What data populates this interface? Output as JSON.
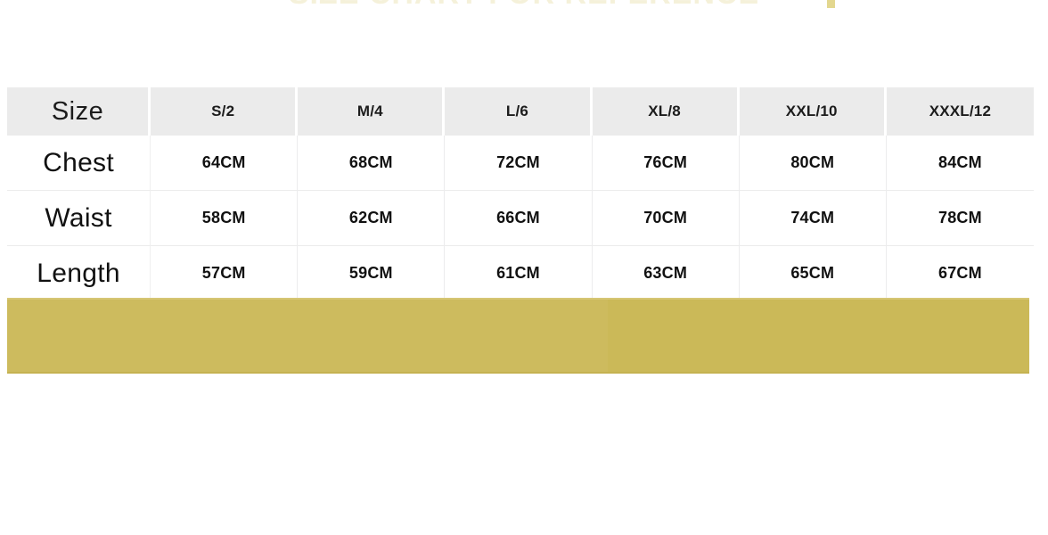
{
  "banner": {
    "title_text": "SIZE CHART FOR REFERENCE",
    "title_color": "#f4efd4",
    "accent_color": "#d9c96a"
  },
  "size_chart": {
    "columns": [
      "Size",
      "S/2",
      "M/4",
      "L/6",
      "XL/8",
      "XXL/10",
      "XXXL/12"
    ],
    "rows": [
      {
        "label": "Chest",
        "values": [
          "64CM",
          "68CM",
          "72CM",
          "76CM",
          "80CM",
          "84CM"
        ]
      },
      {
        "label": "Waist",
        "values": [
          "58CM",
          "62CM",
          "66CM",
          "70CM",
          "74CM",
          "78CM"
        ]
      },
      {
        "label": "Length",
        "values": [
          "57CM",
          "59CM",
          "61CM",
          "63CM",
          "65CM",
          "67CM"
        ]
      }
    ],
    "header_bg": "#ebebeb",
    "body_bg": "#ffffff",
    "border_color": "#ececec",
    "text_color": "#111111"
  },
  "gold_banner": {
    "color": "#ccba5b",
    "color_left": "#cdbb5e",
    "color_right": "#cbb958"
  }
}
